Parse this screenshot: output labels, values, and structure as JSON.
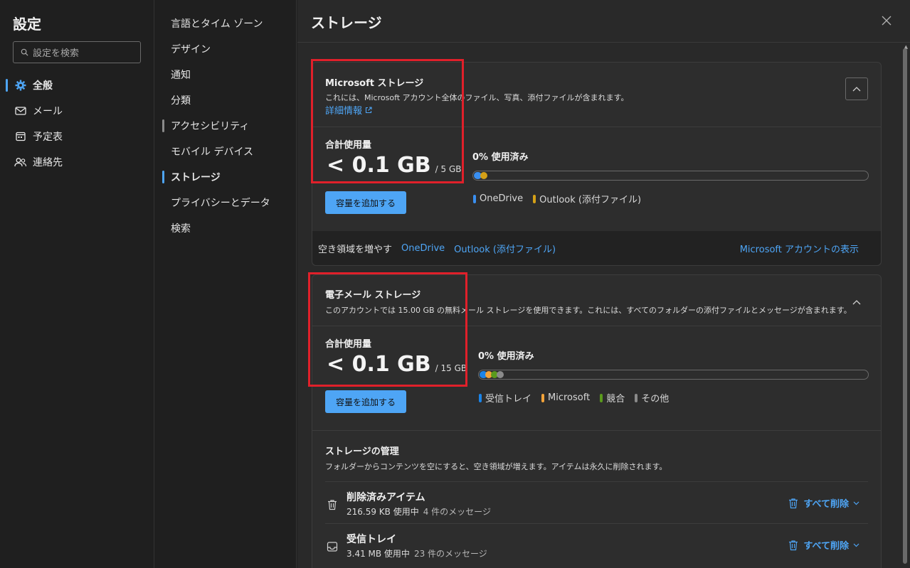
{
  "sidebar": {
    "title": "設定",
    "search_placeholder": "設定を検索",
    "items": [
      {
        "label": "全般"
      },
      {
        "label": "メール"
      },
      {
        "label": "予定表"
      },
      {
        "label": "連絡先"
      }
    ]
  },
  "middle": {
    "items": [
      {
        "label": "言語とタイム ゾーン"
      },
      {
        "label": "デザイン"
      },
      {
        "label": "通知"
      },
      {
        "label": "分類"
      },
      {
        "label": "アクセシビリティ"
      },
      {
        "label": "モバイル デバイス"
      },
      {
        "label": "ストレージ"
      },
      {
        "label": "プライバシーとデータ"
      },
      {
        "label": "検索"
      }
    ]
  },
  "pane": {
    "title": "ストレージ"
  },
  "ms_storage": {
    "title": "Microsoft ストレージ",
    "desc": "これには、Microsoft アカウント全体のファイル、写真、添付ファイルが含まれます。",
    "learn_more": "詳細情報",
    "usage_label": "合計使用量",
    "usage_value": "< 0.1 GB",
    "usage_total": "/ 5 GB",
    "add_button": "容量を追加する",
    "percent_label": "0% 使用済み",
    "used_percent": 0,
    "legend": [
      {
        "label": "OneDrive",
        "color": "#3a8ff0"
      },
      {
        "label": "Outlook (添付ファイル)",
        "color": "#d4a017"
      }
    ],
    "free_up_label": "空き領域を増やす",
    "free_up_links": [
      "OneDrive",
      "Outlook (添付ファイル)"
    ],
    "account_link": "Microsoft アカウントの表示"
  },
  "mail_storage": {
    "title": "電子メール ストレージ",
    "desc": "このアカウントでは 15.00 GB の無料メール ストレージを使用できます。これには、すべてのフォルダーの添付ファイルとメッセージが含まれます。",
    "usage_label": "合計使用量",
    "usage_value": "< 0.1 GB",
    "usage_total": "/ 15 GB",
    "add_button": "容量を追加する",
    "percent_label": "0% 使用済み",
    "used_percent": 0,
    "legend": [
      {
        "label": "受信トレイ",
        "color": "#1a84e8"
      },
      {
        "label": "Microsoft",
        "color": "#f2a33a"
      },
      {
        "label": "競合",
        "color": "#5a9a1c"
      },
      {
        "label": "その他",
        "color": "#8a8a8a"
      }
    ],
    "mgmt_title": "ストレージの管理",
    "mgmt_desc": "フォルダーからコンテンツを空にすると、空き領域が増えます。アイテムは永久に削除されます。",
    "folders": [
      {
        "name": "削除済みアイテム",
        "size": "216.59 KB 使用中",
        "count": "4 件のメッセージ",
        "action": "すべて削除",
        "icon": "trash-icon"
      },
      {
        "name": "受信トレイ",
        "size": "3.41 MB 使用中",
        "count": "23 件のメッセージ",
        "action": "すべて削除",
        "icon": "inbox-icon"
      }
    ]
  }
}
